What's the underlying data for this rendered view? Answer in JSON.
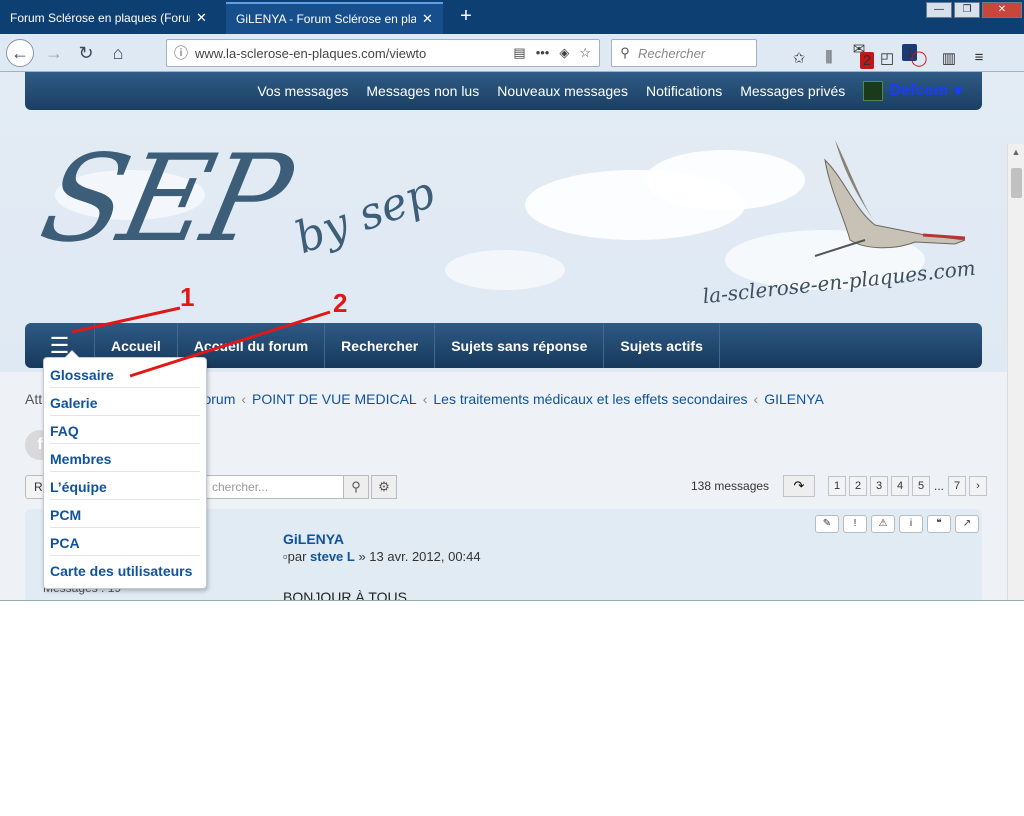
{
  "browser": {
    "tabs": [
      {
        "title": "Forum Sclérose en plaques (Forum",
        "close": "✕"
      },
      {
        "title": "GiLENYA - Forum Sclérose en plaq",
        "close": "✕"
      }
    ],
    "new_tab": "+",
    "url": "www.la-sclerose-en-plaques.com/viewto",
    "search_placeholder": "Rechercher",
    "badges": {
      "addon1": "2",
      "addon2": "1"
    }
  },
  "topnav": {
    "items": [
      "Vos messages",
      "Messages non lus",
      "Nouveaux messages",
      "Notifications",
      "Messages privés"
    ],
    "user": "Defcom"
  },
  "banner": {
    "logo_main": "SEP",
    "logo_sub": "by sep",
    "domain": "la-sclerose-en-plaques.com"
  },
  "mainnav": {
    "hamburger": "☰",
    "items": [
      "Accueil",
      "Accueil du forum",
      "Rechercher",
      "Sujets sans réponse",
      "Sujets actifs"
    ]
  },
  "breadcrumb": {
    "items": [
      "Att",
      "du forum",
      "POINT DE VUE MEDICAL",
      "Les traitements médicaux et les effets secondaires",
      "GILENYA"
    ],
    "separator": "‹"
  },
  "topic": {
    "title_visible": "A",
    "reply_button": "R",
    "search_placeholder": "chercher...",
    "message_count": "138 messages",
    "pages": [
      "1",
      "2",
      "3",
      "4",
      "5",
      "7"
    ],
    "ellipsis": "..."
  },
  "post": {
    "title": "GiLENYA",
    "meta_prefix": "par",
    "author": "steve L",
    "date": "» 13 avr. 2012, 00:44",
    "body": "BONJOUR À TOUS",
    "profile_text": "Messages : 19",
    "tools": [
      "✎",
      "!",
      "⚠",
      "i",
      "❝",
      "↗"
    ]
  },
  "dropdown": {
    "items": [
      "Glossaire",
      "Galerie",
      "FAQ",
      "Membres",
      "L’équipe",
      "PCM",
      "PCA",
      "Carte des utilisateurs"
    ]
  },
  "annotations": {
    "label1": "1",
    "label2": "2",
    "color": "#e01818"
  }
}
